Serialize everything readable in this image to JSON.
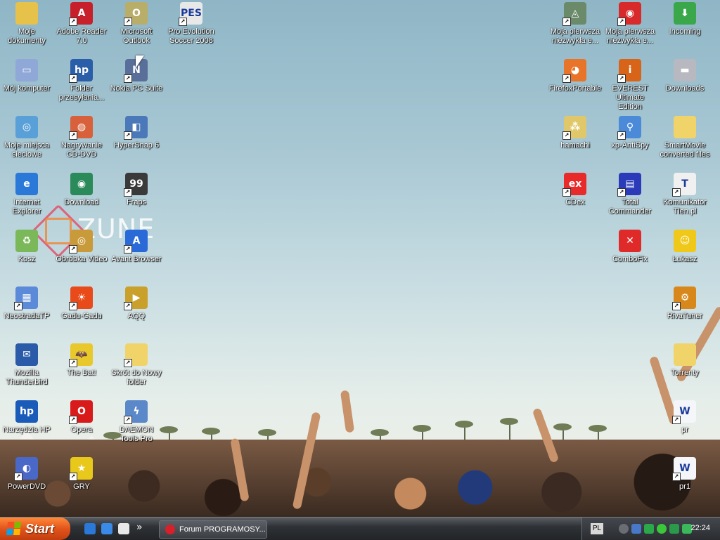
{
  "desktop": {
    "icons": [
      {
        "label": "Moje dokumenty",
        "icon": "folder-documents-icon",
        "color": "#e7c24a",
        "glyph": "",
        "shortcut": false
      },
      {
        "label": "Adobe Reader 7.0",
        "icon": "adobe-reader-icon",
        "color": "#c8202a",
        "glyph": "A",
        "shortcut": true
      },
      {
        "label": "Microsoft Outlook",
        "icon": "outlook-icon",
        "color": "#b9ad6a",
        "glyph": "O",
        "shortcut": true
      },
      {
        "label": "Pro Evolution Soccer 2008",
        "icon": "pes-icon",
        "color": "#e8e8e8",
        "glyph": "PES",
        "shortcut": true
      },
      {
        "label": "Mój komputer",
        "icon": "my-computer-icon",
        "color": "#8fa8d8",
        "glyph": "▭",
        "shortcut": false
      },
      {
        "label": "Folder przesyłania...",
        "icon": "hp-folder-icon",
        "color": "#2a5ea8",
        "glyph": "hp",
        "shortcut": true
      },
      {
        "label": "Nokia PC Suite",
        "icon": "nokia-icon",
        "color": "#5a6e9a",
        "glyph": "N",
        "shortcut": true
      },
      {
        "label": "Moje miejsca sieciowe",
        "icon": "network-places-icon",
        "color": "#5aa0d8",
        "glyph": "◎",
        "shortcut": false
      },
      {
        "label": "Nagrywanie CD-DVD",
        "icon": "nero-icon",
        "color": "#d8603a",
        "glyph": "◍",
        "shortcut": true
      },
      {
        "label": "HyperSnap 6",
        "icon": "hypersnap-icon",
        "color": "#4a78b8",
        "glyph": "◧",
        "shortcut": true
      },
      {
        "label": "Internet Explorer",
        "icon": "internet-explorer-icon",
        "color": "#2a78d8",
        "glyph": "e",
        "shortcut": false
      },
      {
        "label": "Download",
        "icon": "download-globe-icon",
        "color": "#2a8a5a",
        "glyph": "◉",
        "shortcut": false
      },
      {
        "label": "Fraps",
        "icon": "fraps-icon",
        "color": "#3a3a3a",
        "glyph": "99",
        "shortcut": true
      },
      {
        "label": "Kosz",
        "icon": "recycle-bin-icon",
        "color": "#7ab85a",
        "glyph": "♻",
        "shortcut": false
      },
      {
        "label": "Obróbka Video",
        "icon": "video-reel-icon",
        "color": "#c89a3a",
        "glyph": "◎",
        "shortcut": true
      },
      {
        "label": "Avant Browser",
        "icon": "avant-browser-icon",
        "color": "#2a6ad8",
        "glyph": "A",
        "shortcut": true
      },
      {
        "label": "NeostradaTP",
        "icon": "neostrada-icon",
        "color": "#5a8ad8",
        "glyph": "▦",
        "shortcut": true
      },
      {
        "label": "Gadu-Gadu",
        "icon": "gadu-gadu-icon",
        "color": "#e84a1a",
        "glyph": "☀",
        "shortcut": true
      },
      {
        "label": "AQQ",
        "icon": "aqq-icon",
        "color": "#c8a02a",
        "glyph": "▶",
        "shortcut": true
      },
      {
        "label": "Mozilla Thunderbird",
        "icon": "thunderbird-icon",
        "color": "#2a5aa8",
        "glyph": "✉",
        "shortcut": false
      },
      {
        "label": "The Bat!",
        "icon": "the-bat-icon",
        "color": "#e8c82a",
        "glyph": "🦇",
        "shortcut": true
      },
      {
        "label": "Skrót do Nowy folder",
        "icon": "folder-icon",
        "color": "#f0d46a",
        "glyph": "",
        "shortcut": true
      },
      {
        "label": "Narzędzia HP",
        "icon": "hp-tools-icon",
        "color": "#1a5ab8",
        "glyph": "hp",
        "shortcut": false
      },
      {
        "label": "Opera",
        "icon": "opera-icon",
        "color": "#d81a1a",
        "glyph": "O",
        "shortcut": true
      },
      {
        "label": "DAEMON Tools Pro",
        "icon": "daemon-tools-icon",
        "color": "#5a88c8",
        "glyph": "ϟ",
        "shortcut": true
      },
      {
        "label": "PowerDVD",
        "icon": "powerdvd-icon",
        "color": "#4a68c8",
        "glyph": "◐",
        "shortcut": true
      },
      {
        "label": "GRY",
        "icon": "games-star-icon",
        "color": "#e8c81a",
        "glyph": "★",
        "shortcut": true
      },
      {
        "label": "Moja pierwsza niezwykła e...",
        "icon": "spaceship-icon",
        "color": "#6a8a6a",
        "glyph": "◬",
        "shortcut": true
      },
      {
        "label": "Moja pierwsza niezwykła e...",
        "icon": "red-robot-icon",
        "color": "#d82a2a",
        "glyph": "◉",
        "shortcut": true
      },
      {
        "label": "Incoming",
        "icon": "incoming-folder-icon",
        "color": "#3aa84a",
        "glyph": "⬇",
        "shortcut": false
      },
      {
        "label": "FirefoxPortable",
        "icon": "firefox-icon",
        "color": "#e8742a",
        "glyph": "◕",
        "shortcut": true
      },
      {
        "label": "EVEREST Ultimate Edition",
        "icon": "everest-icon",
        "color": "#d8641a",
        "glyph": "i",
        "shortcut": true
      },
      {
        "label": "Downloads",
        "icon": "drive-icon",
        "color": "#b8b8c0",
        "glyph": "▬",
        "shortcut": false
      },
      {
        "label": "hamachi",
        "icon": "hamachi-icon",
        "color": "#e0c86a",
        "glyph": "⁂",
        "shortcut": true
      },
      {
        "label": "xp-AntiSpy",
        "icon": "xp-antispy-icon",
        "color": "#4a8ad8",
        "glyph": "⚲",
        "shortcut": true
      },
      {
        "label": "SmartMovie converted files",
        "icon": "folder-icon",
        "color": "#f0d46a",
        "glyph": "",
        "shortcut": false
      },
      {
        "label": "CDex",
        "icon": "cdex-icon",
        "color": "#e82a2a",
        "glyph": "ex",
        "shortcut": true
      },
      {
        "label": "Total Commander",
        "icon": "total-commander-icon",
        "color": "#2a3ab8",
        "glyph": "▤",
        "shortcut": true
      },
      {
        "label": "Komunikator Tlen.pl",
        "icon": "tlen-icon",
        "color": "#f0f0f0",
        "glyph": "T",
        "shortcut": true
      },
      {
        "label": "ComboFix",
        "icon": "combofix-icon",
        "color": "#e02a2a",
        "glyph": "✕",
        "shortcut": false
      },
      {
        "label": "Łukasz",
        "icon": "user-smiley-icon",
        "color": "#f0c81a",
        "glyph": "☺",
        "shortcut": false
      },
      {
        "label": "RivaTuner",
        "icon": "rivatuner-icon",
        "color": "#d8881a",
        "glyph": "⚙",
        "shortcut": true
      },
      {
        "label": "Torrenty",
        "icon": "folder-icon",
        "color": "#f0d46a",
        "glyph": "",
        "shortcut": false
      },
      {
        "label": "pr",
        "icon": "word-document-icon",
        "color": "#f4f6fa",
        "glyph": "W",
        "shortcut": true
      },
      {
        "label": "pr1",
        "icon": "word-document-icon",
        "color": "#f4f6fa",
        "glyph": "W",
        "shortcut": true
      }
    ],
    "watermark_text": "ZUNE"
  },
  "taskbar": {
    "start_label": "Start",
    "quick_launch": [
      "internet-explorer-icon",
      "ie-alt-icon",
      "window-icon"
    ],
    "overflow": "»",
    "task_label": "Forum PROGRAMOSY...",
    "language": "PL",
    "clock": "22:24"
  }
}
